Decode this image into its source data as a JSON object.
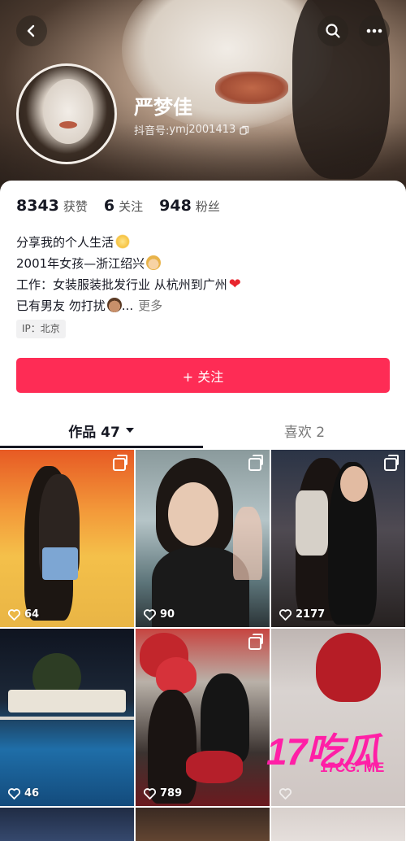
{
  "header": {
    "name": "严梦佳",
    "douyin_id_label": "抖音号: ",
    "douyin_id": "ymj2001413"
  },
  "stats": [
    {
      "num": "8343",
      "label": "获赞"
    },
    {
      "num": "6",
      "label": "关注"
    },
    {
      "num": "948",
      "label": "粉丝"
    }
  ],
  "bio": {
    "line1": "分享我的个人生活",
    "line2": "2001年女孩—浙江绍兴",
    "line3": "工作：女装服装批发行业 从杭州到广州",
    "line4": "已有男友  勿打扰",
    "line4_ellipsis": "...",
    "more": "更多"
  },
  "ip": "IP：北京",
  "follow_button": "+ 关注",
  "tabs": {
    "works": "作品 47",
    "likes": "喜欢 2"
  },
  "videos": [
    {
      "likes": "64"
    },
    {
      "likes": "90"
    },
    {
      "likes": "2177"
    },
    {
      "likes": "46"
    },
    {
      "likes": "789"
    },
    {
      "likes": ""
    }
  ],
  "watermark": {
    "big": "17吃瓜",
    "small": "17CG. ME"
  },
  "icons": [
    "back-icon",
    "search-icon",
    "more-icon",
    "copy-icon",
    "heart-outline-icon",
    "multi-image-icon",
    "triangle-down-icon"
  ]
}
